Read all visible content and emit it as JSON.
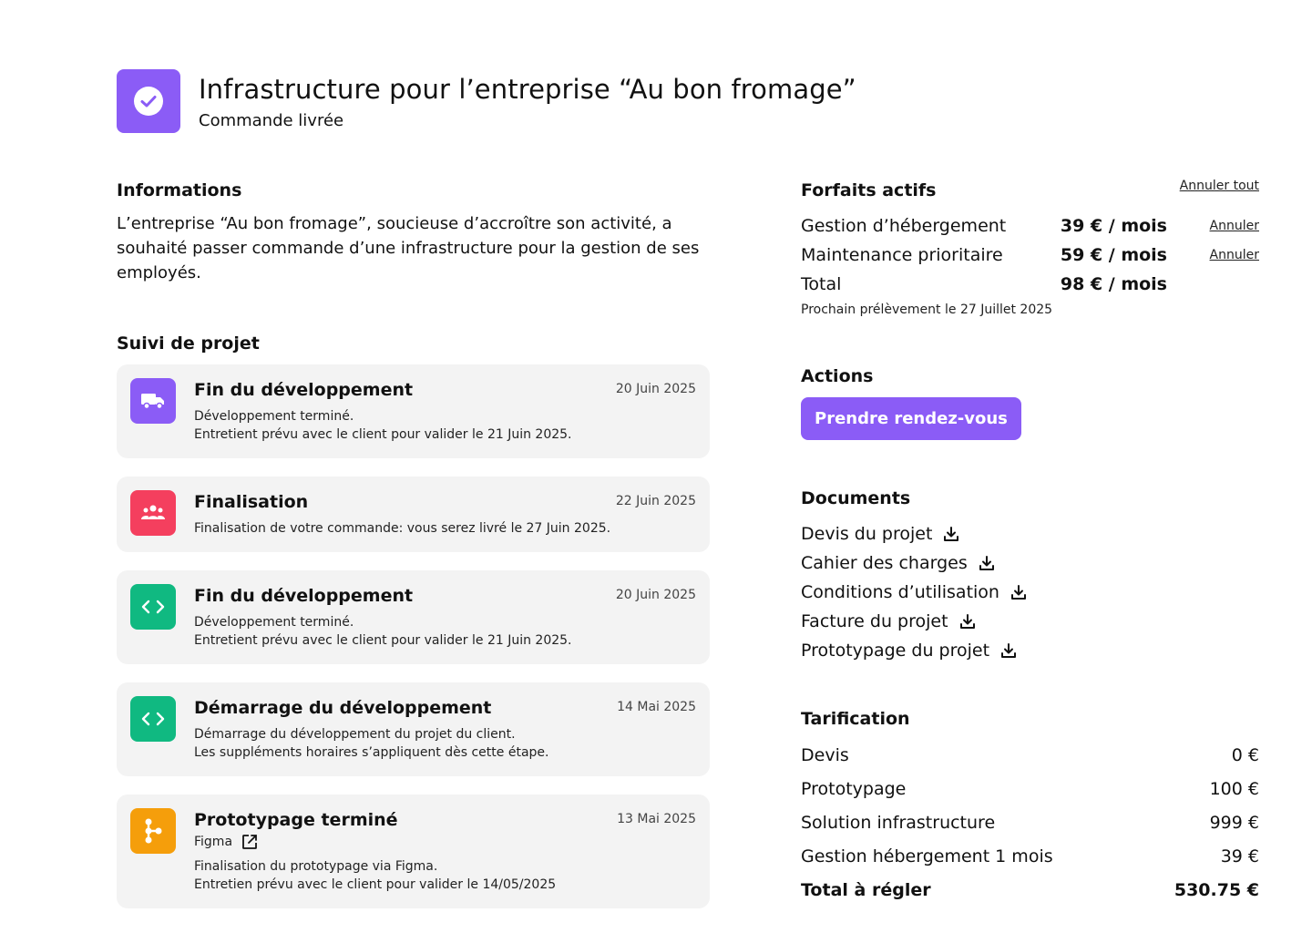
{
  "header": {
    "title": "Infrastructure pour l’entreprise “Au bon fromage”",
    "status": "Commande livrée",
    "badge_icon": "check-circle-icon",
    "badge_color": "#8b5cf6"
  },
  "informations": {
    "heading": "Informations",
    "text": "L’entreprise “Au bon fromage”, soucieuse d’accroître son activité, a souhaité passer commande d’une infrastructure pour la gestion de ses employés."
  },
  "suivi": {
    "heading": "Suivi de projet",
    "items": [
      {
        "icon": "truck-icon",
        "color": "#8b5cf6",
        "title": "Fin du développement",
        "date": "20 Juin 2025",
        "line1": "Développement terminé.",
        "line2": "Entretient prévu avec le client pour valider le 21 Juin 2025."
      },
      {
        "icon": "people-icon",
        "color": "#f43f5e",
        "title": "Finalisation",
        "date": "22 Juin 2025",
        "line1": "Finalisation de votre commande: vous serez livré le 27 Juin 2025."
      },
      {
        "icon": "code-icon",
        "color": "#10b981",
        "title": "Fin du développement",
        "date": "20 Juin 2025",
        "line1": "Développement terminé.",
        "line2": "Entretient prévu avec le client pour valider le 21 Juin 2025."
      },
      {
        "icon": "code-icon",
        "color": "#10b981",
        "title": "Démarrage du développement",
        "date": "14 Mai 2025",
        "line1": "Démarrage du développement du projet du client.",
        "line2": "Les suppléments horaires s’appliquent dès cette étape."
      },
      {
        "icon": "figma-icon",
        "color": "#f59e0b",
        "title": "Prototypage terminé",
        "date": "13 Mai 2025",
        "tool": "Figma",
        "line1": "Finalisation du prototypage via Figma.",
        "line2": "Entretien prévu avec le client pour valider le 14/05/2025"
      }
    ]
  },
  "forfaits": {
    "heading": "Forfaits actifs",
    "cancel_all": "Annuler tout",
    "rows": [
      {
        "name": "Gestion d’hébergement",
        "price": "39 € / mois",
        "cancel": "Annuler"
      },
      {
        "name": "Maintenance prioritaire",
        "price": "59 € / mois",
        "cancel": "Annuler"
      },
      {
        "name": "Total",
        "price": "98 € / mois"
      }
    ],
    "next_debit": "Prochain prélèvement le 27 Juillet 2025"
  },
  "actions": {
    "heading": "Actions",
    "button": "Prendre rendez-vous"
  },
  "documents": {
    "heading": "Documents",
    "items": [
      "Devis du projet",
      "Cahier des charges",
      "Conditions d’utilisation",
      "Facture du projet",
      "Prototypage du projet"
    ]
  },
  "tarification": {
    "heading": "Tarification",
    "rows": [
      {
        "label": "Devis",
        "value": "0 €"
      },
      {
        "label": "Prototypage",
        "value": "100 €"
      },
      {
        "label": "Solution infrastructure",
        "value": "999 €"
      },
      {
        "label": "Gestion hébergement 1 mois",
        "value": "39 €"
      }
    ],
    "total": {
      "label": "Total à régler",
      "value": "530.75 €"
    }
  },
  "colors": {
    "accent": "#8b5cf6",
    "card_bg": "#f3f3f3"
  }
}
